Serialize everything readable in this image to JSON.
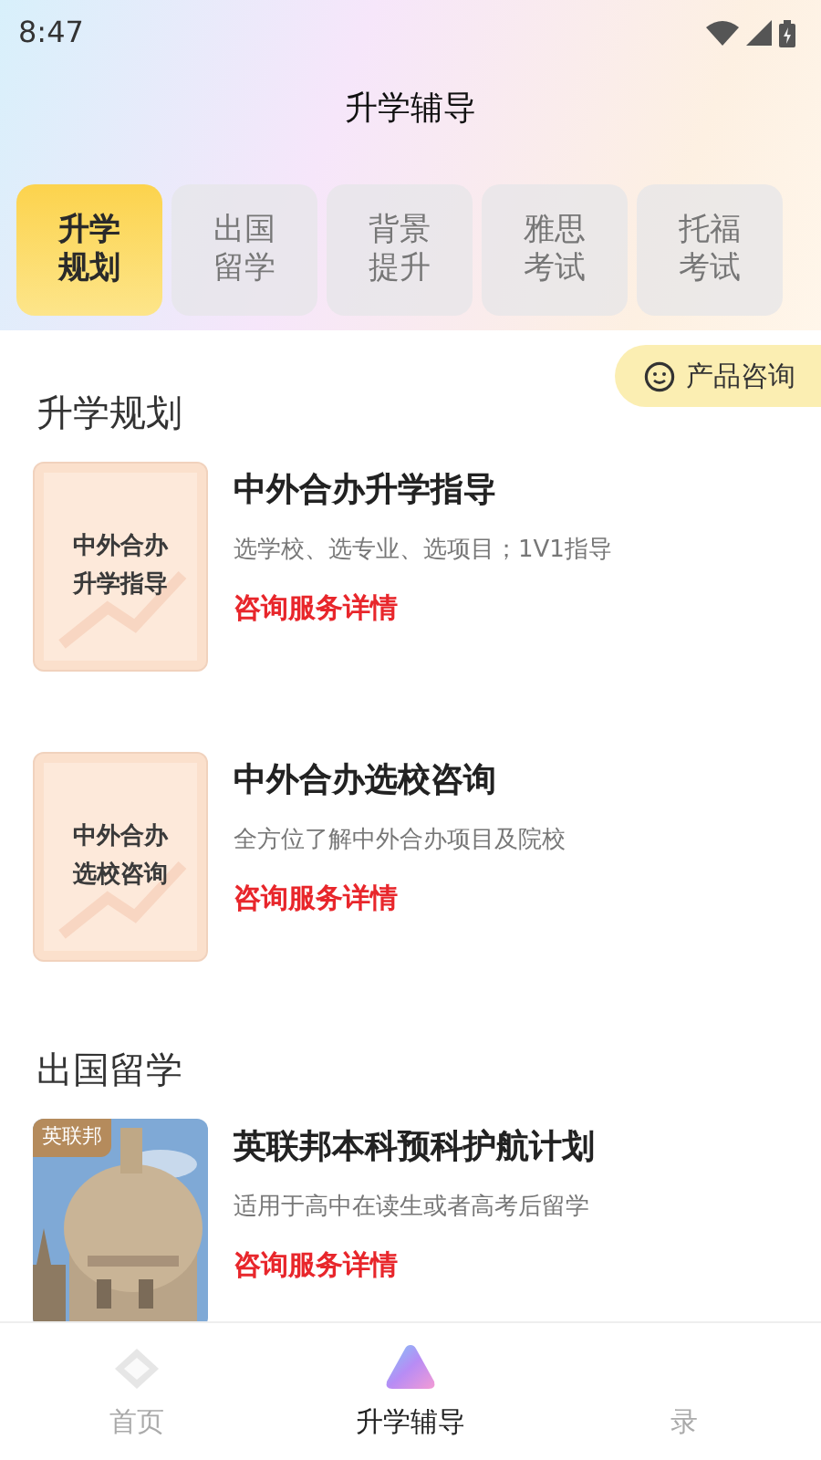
{
  "status_bar": {
    "time": "8:47"
  },
  "header": {
    "title": "升学辅导"
  },
  "tabs": [
    {
      "label": "升学规划",
      "selected": true
    },
    {
      "label": "出国留学",
      "selected": false
    },
    {
      "label": "背景提升",
      "selected": false
    },
    {
      "label": "雅思考试",
      "selected": false
    },
    {
      "label": "托福考试",
      "selected": false
    }
  ],
  "float_button": {
    "label": "产品咨询"
  },
  "sections": [
    {
      "title": "升学规划",
      "items": [
        {
          "kind": "card",
          "thumb_text": "中外合办升学指导",
          "title": "中外合办升学指导",
          "subtitle": "选学校、选专业、选项目；1V1指导",
          "link": "咨询服务详情"
        },
        {
          "kind": "card",
          "thumb_text": "中外合办选校咨询",
          "title": "中外合办选校咨询",
          "subtitle": "全方位了解中外合办项目及院校",
          "link": "咨询服务详情"
        }
      ]
    },
    {
      "title": "出国留学",
      "items": [
        {
          "kind": "picture",
          "tag": "英联邦",
          "title": "英联邦本科预科护航计划",
          "subtitle": "适用于高中在读生或者高考后留学",
          "link": "咨询服务详情"
        }
      ]
    }
  ],
  "bottom_nav": [
    {
      "label": "首页",
      "selected": false
    },
    {
      "label": "升学辅导",
      "selected": true
    },
    {
      "label": "录",
      "selected": false
    }
  ]
}
